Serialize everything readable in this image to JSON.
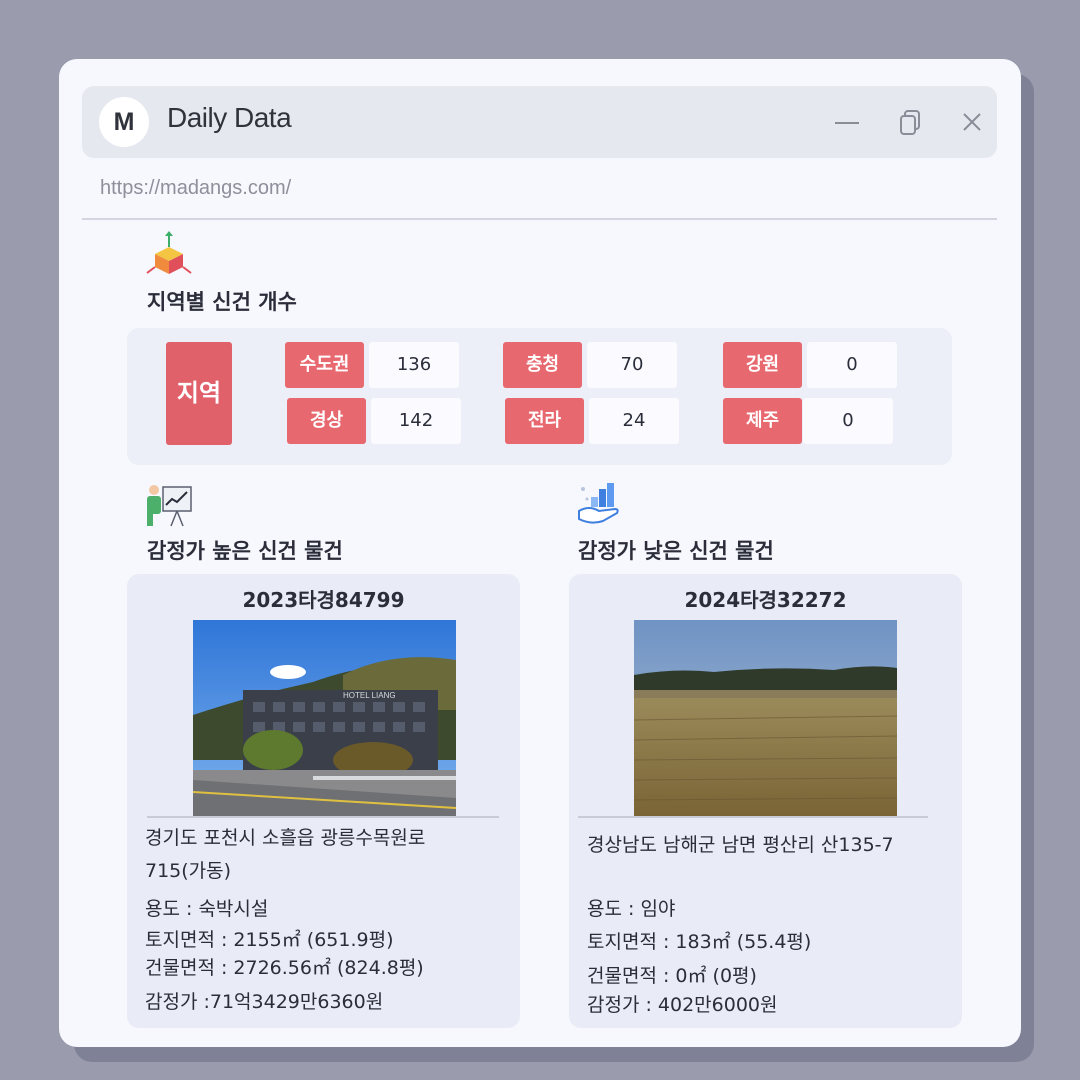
{
  "window": {
    "logo_letter": "M",
    "title": "Daily Data",
    "url": "https://madangs.com/"
  },
  "icons": {
    "minimize": "minimize-icon",
    "restore": "restore-icon",
    "close": "close-icon",
    "region_section": "3d-axis-cube-icon",
    "high_section": "presentation-chart-icon",
    "low_section": "hand-bar-chart-icon"
  },
  "regions": {
    "section_title": "지역별 신건 개수",
    "main_label": "지역",
    "items": [
      {
        "name": "수도권",
        "count": "136"
      },
      {
        "name": "경상",
        "count": "142"
      },
      {
        "name": "충청",
        "count": "70"
      },
      {
        "name": "전라",
        "count": "24"
      },
      {
        "name": "강원",
        "count": "0"
      },
      {
        "name": "제주",
        "count": "0"
      }
    ]
  },
  "high": {
    "section_title": "감정가 높은 신건 물건",
    "case_no": "2023타경84799",
    "address_line1": "경기도 포천시 소흘읍 광릉수목원로",
    "address_line2": "715(가동)",
    "usage": "용도 : 숙박시설",
    "land_area": "토지면적 : 2155㎡ (651.9평)",
    "building_area": "건물면적 : 2726.56㎡ (824.8평)",
    "price": "감정가 :71억3429만6360원",
    "sign_text": "HOTEL LIANG"
  },
  "low": {
    "section_title": "감정가 낮은 신건 물건",
    "case_no": "2024타경32272",
    "address_line1": "경상남도 남해군 남면 평산리 산135-7",
    "usage": "용도 :  임야",
    "land_area": "토지면적 : 183㎡ (55.4평)",
    "building_area": "건물면적 : 0㎡ (0평)",
    "price": "감정가 : 402만6000원"
  },
  "colors": {
    "background": "#9a9cae",
    "window": "#f7f8fd",
    "accent_red": "#e8686f",
    "panel": "#eceef8"
  }
}
